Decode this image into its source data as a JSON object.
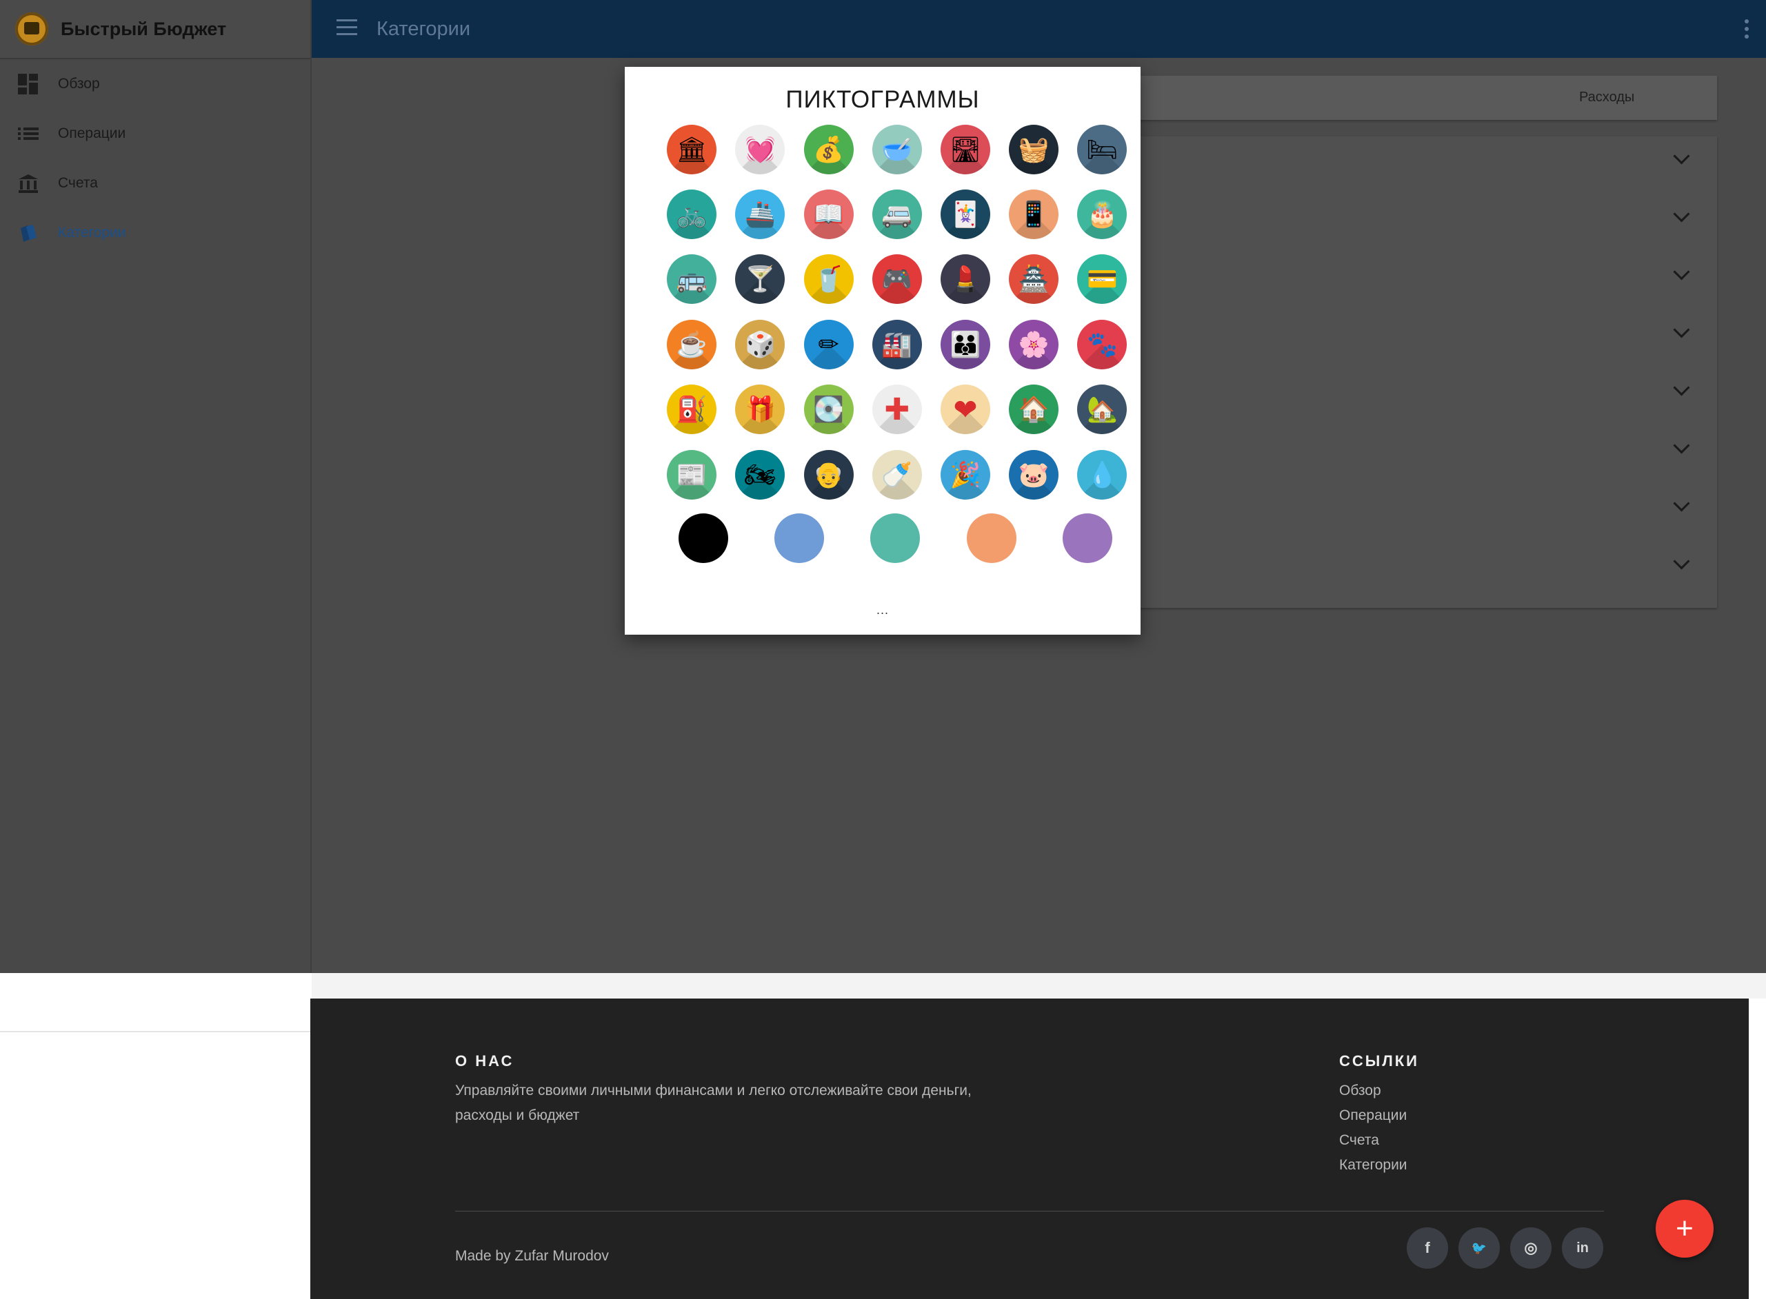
{
  "app": {
    "name": "Быстрый Бюджет"
  },
  "header": {
    "title": "Категории"
  },
  "sidebar": {
    "items": [
      {
        "label": "Обзор",
        "icon": "dashboard-icon"
      },
      {
        "label": "Операции",
        "icon": "list-icon"
      },
      {
        "label": "Счета",
        "icon": "bank-icon"
      },
      {
        "label": "Категории",
        "icon": "categories-icon",
        "active": true
      }
    ]
  },
  "tabs": {
    "expenses_label": "Расходы"
  },
  "modal": {
    "title": "ПИКТОГРАММЫ",
    "more": "...",
    "icons": [
      [
        "bank-icon",
        "heart-rate-icon",
        "coins-growth-icon",
        "food-bowl-icon",
        "road-icon",
        "basket-icon",
        "bed-icon"
      ],
      [
        "bicycle-icon",
        "ship-icon",
        "book-icon",
        "minivan-icon",
        "playing-cards-icon",
        "smartphone-icon",
        "cake-icon"
      ],
      [
        "bus-icon",
        "cocktail-icon",
        "coffee-cup-icon",
        "gamepad-icon",
        "cosmetics-icon",
        "temple-icon",
        "credit-card-icon"
      ],
      [
        "mug-icon",
        "dice-icon",
        "ruler-pencil-icon",
        "factory-icon",
        "family-icon",
        "flower-pot-icon",
        "paw-icon"
      ],
      [
        "fuel-station-icon",
        "gift-icon",
        "hard-drive-icon",
        "medical-cross-icon",
        "heart-icon",
        "house-icon",
        "home-icon"
      ],
      [
        "newspaper-icon",
        "motorcycle-icon",
        "grandfather-icon",
        "pacifier-icon",
        "party-hat-icon",
        "piggy-bank-icon",
        "water-drop-icon"
      ]
    ],
    "icon_colors": [
      [
        "#e9542e",
        "#eeeeee",
        "#4caf50",
        "#94cbbf",
        "#dc4d58",
        "#1e2b36",
        "#4c6b85"
      ],
      [
        "#26a69a",
        "#3fb4e8",
        "#e96b6b",
        "#44b39a",
        "#1a4860",
        "#f0a070",
        "#3fb79d"
      ],
      [
        "#43b09c",
        "#2e3e4e",
        "#f2c200",
        "#e23a3a",
        "#3b3b4d",
        "#e24d3c",
        "#2db99e"
      ],
      [
        "#f48024",
        "#d6a74a",
        "#1e8fd4",
        "#2c4a6b",
        "#7a4d9e",
        "#8e4aa4",
        "#e23e4e"
      ],
      [
        "#f2c200",
        "#e8b83c",
        "#8bc34a",
        "#eeeeee",
        "#f7d9a3",
        "#2a9e5c",
        "#3b5268"
      ],
      [
        "#55b984",
        "#00838f",
        "#27384a",
        "#e8e0c0",
        "#3da5d9",
        "#1a6fae",
        "#3db4d6"
      ]
    ],
    "swatches": [
      "#000000",
      "#6f9bd7",
      "#56b8a7",
      "#f39c6c",
      "#9b74be"
    ]
  },
  "footer": {
    "about_title": "О НАС",
    "about_line1": "Управляйте своими личными финансами и легко отслеживайте свои деньги,",
    "about_line2": "расходы и бюджет",
    "links_title": "ССЫЛКИ",
    "links": [
      "Обзор",
      "Операции",
      "Счета",
      "Категории"
    ],
    "credit": "Made by Zufar Murodov",
    "social": [
      {
        "icon": "facebook-icon",
        "glyph": "f"
      },
      {
        "icon": "twitter-icon",
        "glyph": "🐦"
      },
      {
        "icon": "dribbble-icon",
        "glyph": "◎"
      },
      {
        "icon": "linkedin-icon",
        "glyph": "in"
      }
    ]
  },
  "fab": {
    "label": "+"
  }
}
